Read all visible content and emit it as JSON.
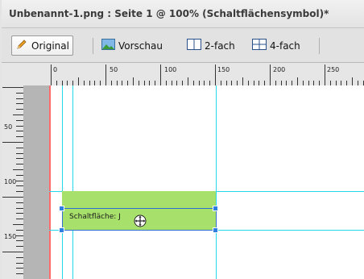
{
  "window": {
    "title": "Unbenannt-1.png : Seite 1 @ 100% (Schaltflächensymbol)*"
  },
  "toolbar": {
    "original_label": "Original",
    "preview_label": "Vorschau",
    "twoup_label": "2-fach",
    "fourup_label": "4-fach",
    "active_view": "Original"
  },
  "rulers": {
    "horizontal_labels": [
      "0",
      "50",
      "100",
      "150",
      "200",
      "250"
    ],
    "vertical_labels": [
      "50",
      "100",
      "150"
    ]
  },
  "slice": {
    "label": "Schaltfläche: J",
    "color": "#a8e06c"
  },
  "colors": {
    "guide": "#29d8ec",
    "selection": "#2f7fe0",
    "margin_line": "#ff6a6a"
  }
}
